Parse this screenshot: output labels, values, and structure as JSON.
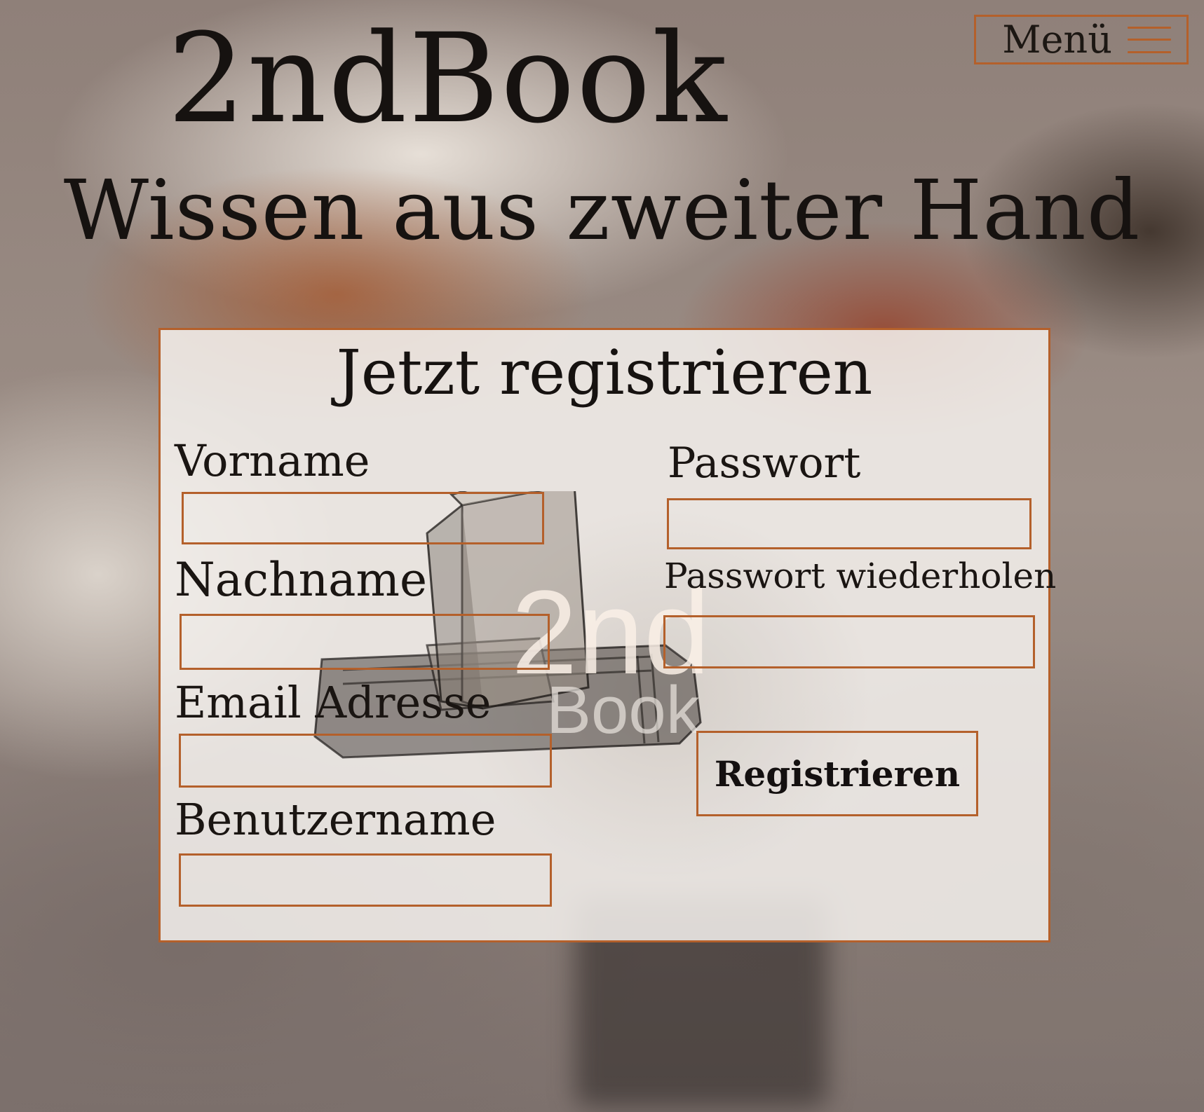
{
  "header": {
    "site_title": "2ndBook",
    "tagline": "Wissen aus zweiter Hand",
    "menu_label": "Menü"
  },
  "form": {
    "title": "Jetzt registrieren",
    "fields": {
      "first_name": {
        "label": "Vorname",
        "value": ""
      },
      "last_name": {
        "label": "Nachname",
        "value": ""
      },
      "email": {
        "label": "Email Adresse",
        "value": ""
      },
      "username": {
        "label": "Benutzername",
        "value": ""
      },
      "password": {
        "label": "Passwort",
        "value": ""
      },
      "password_repeat": {
        "label": "Passwort wiederholen",
        "value": ""
      }
    },
    "submit_label": "Registrieren"
  },
  "logo": {
    "text_top": "2nd",
    "text_bottom": "Book"
  },
  "colors": {
    "accent": "#b4602b",
    "text": "#161210"
  },
  "icons": {
    "menu": "hamburger-icon"
  }
}
